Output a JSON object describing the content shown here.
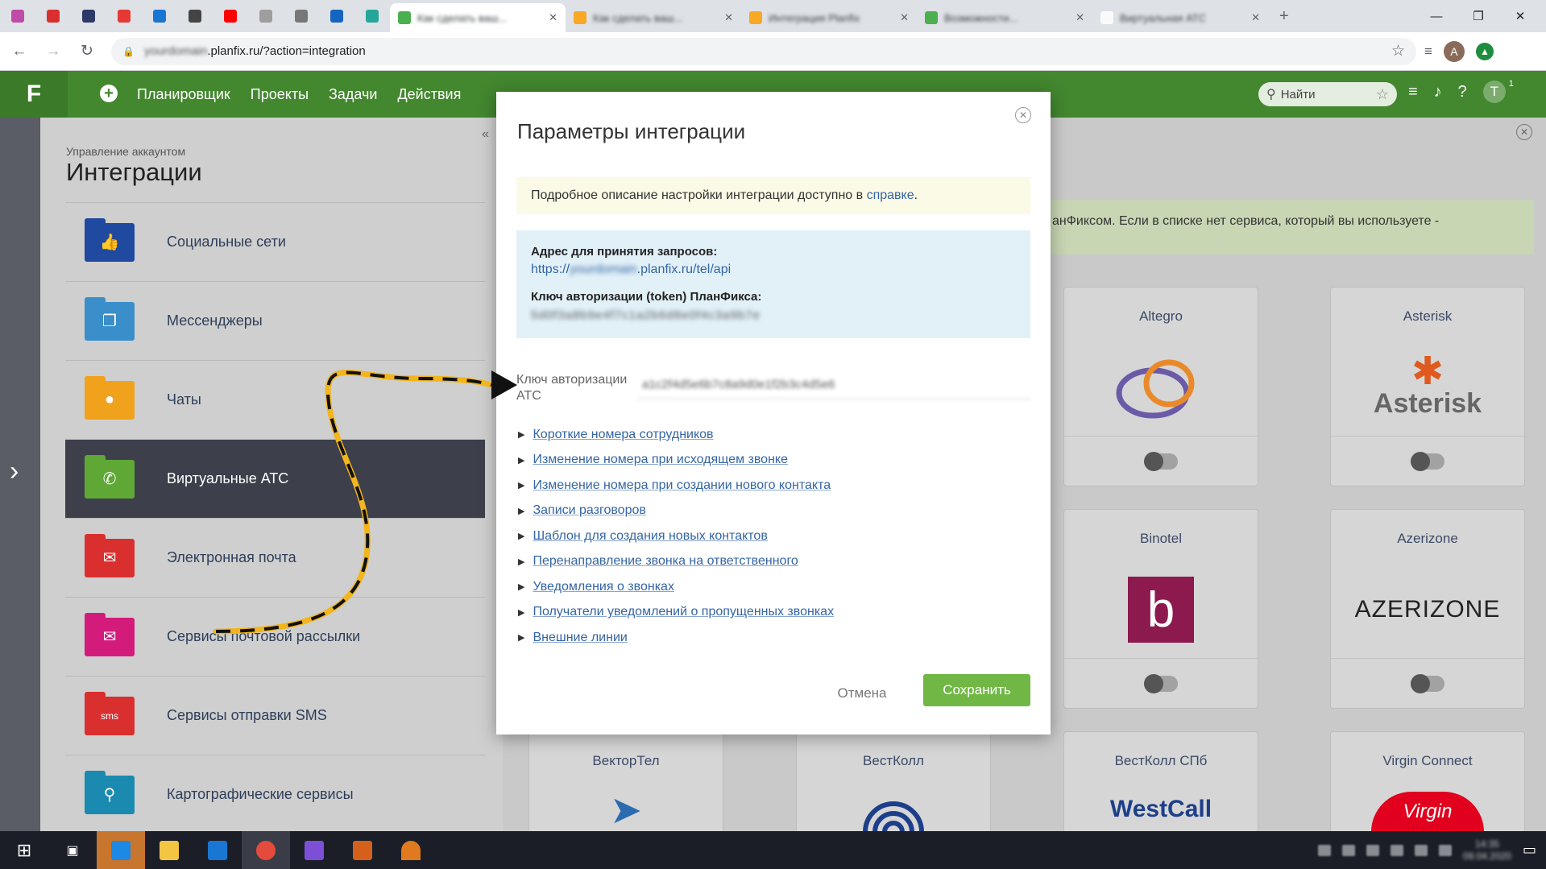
{
  "browser": {
    "tabs": [
      {
        "title": "Как сделать ваш...",
        "color": "#4caf50",
        "active": true
      },
      {
        "title": "Как сделать ваш...",
        "color": "#f9a825",
        "active": false
      },
      {
        "title": "Интеграция Planfix",
        "color": "#f9a825",
        "active": false
      },
      {
        "title": "Возможности...",
        "color": "#4caf50",
        "active": false
      },
      {
        "title": "Виртуальная АТС",
        "color": "#fafafa",
        "active": false
      }
    ],
    "url_prefix": "https://",
    "url_sub": "yourdomain",
    "url_main": ".planfix.ru/?action=integration",
    "avatar_letter": "A"
  },
  "app": {
    "logo": "F",
    "nav": [
      "Планировщик",
      "Проекты",
      "Задачи",
      "Действия"
    ],
    "search_placeholder": "Найти",
    "user_letter": "T",
    "badge": "1"
  },
  "sidebar": {
    "breadcrumb": "Управление аккаунтом",
    "title": "Интеграции",
    "items": [
      {
        "label": "Социальные сети",
        "color": "#1f4aa0",
        "icon": "thumbs-up-icon"
      },
      {
        "label": "Мессенджеры",
        "color": "#3a8ec9",
        "icon": "chat-icon"
      },
      {
        "label": "Чаты",
        "color": "#f0a21c",
        "icon": "chat-bubble-icon"
      },
      {
        "label": "Виртуальные АТС",
        "color": "#5fa836",
        "icon": "phone-icon",
        "active": true
      },
      {
        "label": "Электронная почта",
        "color": "#d9302f",
        "icon": "envelope-icon"
      },
      {
        "label": "Сервисы почтовой рассылки",
        "color": "#d31b7c",
        "icon": "newsletter-icon"
      },
      {
        "label": "Сервисы отправки SMS",
        "color": "#d9302f",
        "icon": "sms-icon"
      },
      {
        "label": "Картографические сервисы",
        "color": "#1b8ab0",
        "icon": "map-pin-icon"
      }
    ]
  },
  "background": {
    "info_text": "анФиксом. Если в списке нет сервиса, который вы используете -",
    "cards": [
      {
        "name": "Altegro"
      },
      {
        "name": "Asterisk"
      },
      {
        "name": "Binotel"
      },
      {
        "name": "Azerizone"
      },
      {
        "name": "ВекторТел"
      },
      {
        "name": "ВестКолл"
      },
      {
        "name": "ВестКолл СПб"
      },
      {
        "name": "Virgin Connect"
      }
    ],
    "logos": {
      "asterisk": "Asterisk",
      "binotel": "b",
      "azerizone": "AZERIZONE",
      "westcall": "WestCall",
      "virgin": "Virgin"
    }
  },
  "modal": {
    "title": "Параметры интеграции",
    "hint_text": "Подробное описание настройки интеграции доступно в ",
    "hint_link": "справке",
    "hint_end": ".",
    "address_label": "Адрес для принятия запросов:",
    "address_prefix": "https://",
    "address_sub": "yourdomain",
    "address_rest": ".planfix.ru/tel/api",
    "token_label": "Ключ авторизации (token) ПланФикса:",
    "token_value": "5d0f3a8b9e4f7c1a2b6d8e0f4c3a9b7e",
    "key_label": "Ключ авторизации АТС",
    "key_value": "a1c2f4d5e6b7c8a9d0e1f2b3c4d5e6",
    "sections": [
      "Короткие номера сотрудников",
      "Изменение номера при исходящем звонке",
      "Изменение номера при создании нового контакта",
      "Записи разговоров",
      "Шаблон для создания новых контактов",
      "Перенаправление звонка на ответственного",
      "Уведомления о звонках",
      "Получатели уведомлений о пропущенных звонках",
      "Внешние линии"
    ],
    "cancel_label": "Отмена",
    "save_label": "Сохранить"
  },
  "taskbar": {
    "clock_time": "14:35",
    "clock_date": "09.04.2020"
  }
}
